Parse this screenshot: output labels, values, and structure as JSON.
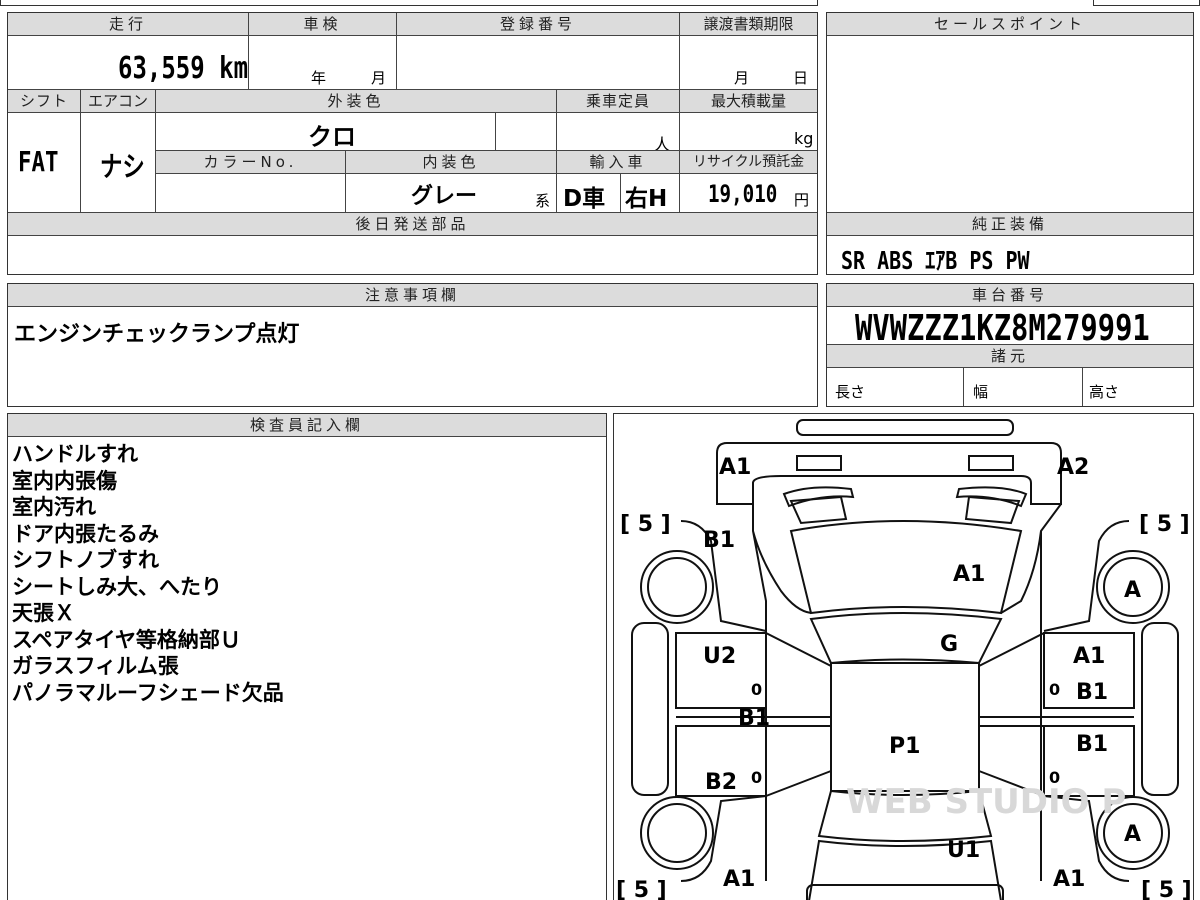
{
  "sheet": {
    "mileage_label": "走行",
    "mileage_value": "63,559 km",
    "inspection_label": "車検",
    "year_label": "年",
    "month_label": "月",
    "registration_label": "登録番号",
    "transfer_deadline_label": "譲渡書類期限",
    "transfer_month": "月",
    "transfer_day": "日",
    "sales_point_label": "セールスポイント",
    "shift_label": "シフト",
    "shift_value": "FAT",
    "aircon_label": "エアコン",
    "aircon_value": "ナシ",
    "exterior_color_label": "外装色",
    "exterior_color_value": "クロ",
    "capacity_label": "乗車定員",
    "capacity_unit": "人",
    "max_load_label": "最大積載量",
    "max_load_unit": "kg",
    "color_no_label": "カラーNo.",
    "interior_color_label": "内装色",
    "interior_color_value": "グレー",
    "interior_color_suffix": "系",
    "import_label": "輸入車",
    "import_type": "D車",
    "handle": "右H",
    "recycle_label": "リサイクル預託金",
    "recycle_value": "19,010",
    "recycle_unit": "円",
    "later_parts_label": "後日発送部品",
    "genuine_equipment_label": "純正装備",
    "genuine_equipment_value": "SR ABS ｴｱB PS PW",
    "caution_label": "注意事項欄",
    "caution_text": "エンジンチェックランプ点灯",
    "chassis_label": "車台番号",
    "chassis_value": "WVWZZZ1KZ8M279991",
    "specs_label": "諸元",
    "length_label": "長さ",
    "width_label": "幅",
    "height_label": "高さ",
    "inspector_label": "検査員記入欄",
    "inspector_notes": [
      "ハンドルすれ",
      "室内内張傷",
      "室内汚れ",
      "ドア内張たるみ",
      "シフトノブすれ",
      "シートしみ大、へたり",
      "天張Ｘ",
      "スペアタイヤ等格納部Ｕ",
      "ガラスフィルム張",
      "パノラマルーフシェード欠品"
    ]
  },
  "diagram": {
    "tire_labels": [
      "[ 5 ]",
      "[ 5 ]",
      "[ 5 ]",
      "[ 5 ]"
    ],
    "marks": [
      "A1",
      "A2",
      "B1",
      "A1",
      "A",
      "U2",
      "G",
      "A1",
      "B1",
      "B1",
      "P1",
      "B1",
      "B2",
      "A",
      "U1",
      "A1",
      "A1"
    ],
    "zeros": [
      "0",
      "0",
      "0",
      "0"
    ],
    "watermark": "WEB STUDIO P"
  }
}
